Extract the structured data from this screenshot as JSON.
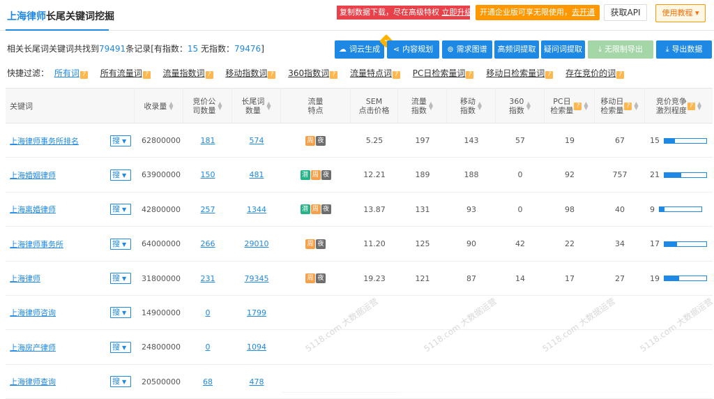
{
  "header": {
    "title_accent": "上海律师",
    "title_rest": "长尾关键词挖掘",
    "promo_red_text": "复制数据下载，尽在高级特权 ",
    "promo_red_link": "立即升级",
    "promo_orange_text": "开通企业版可享无限使用，",
    "promo_orange_link": "去开通",
    "api_label": "获取API",
    "guide_label": "使用教程 ▾"
  },
  "summary": {
    "prefix": "相关长尾词关键词共找到",
    "total": "79491",
    "mid": "条记录[有指数：",
    "with_index": "15",
    "mid2": "  无指数：",
    "without_index": "79476",
    "suffix": "]"
  },
  "actions": [
    {
      "label": "词云生成",
      "icon": "☁"
    },
    {
      "label": "内容规划",
      "icon": "⋖"
    },
    {
      "label": "需求图谱",
      "icon": "⊚"
    },
    {
      "label": "高频词提取",
      "icon": ""
    },
    {
      "label": "疑问词提取",
      "icon": ""
    },
    {
      "label": "无限制导出",
      "icon": "⤓"
    },
    {
      "label": "导出数据",
      "icon": "⤓"
    }
  ],
  "filter": {
    "label": "快捷过滤：",
    "items": [
      "所有词",
      "所有流量词",
      "流量指数词",
      "移动指数词",
      "360指数词",
      "流量特点词",
      "PC日检索量词",
      "移动日检索量词",
      "存在竞价的词"
    ]
  },
  "columns": {
    "keyword": "关键词",
    "indexed": "收录量",
    "bid_companies": "竞价公\n司数量",
    "longtail": "长尾词\n数量",
    "traits": "流量\n特点",
    "sem": "SEM\n点击价格",
    "flow_index": "流量\n指数",
    "mobile_index": "移动\n指数",
    "index_360": "360\n指数",
    "pc_daily": "PC日\n检索量",
    "mobile_daily": "移动日\n检索量",
    "competition": "竞价竞争\n激烈程度"
  },
  "search_tag": "搜",
  "rows": [
    {
      "kw": "上海律师事务所排名",
      "indexed": "62800000",
      "bid": "181",
      "lt": "574",
      "traits": [
        "周",
        "夜"
      ],
      "sem": "5.25",
      "flow": "197",
      "mobile": "143",
      "i360": "57",
      "pc": "19",
      "md": "67",
      "comp": "15",
      "comp_frac": 0.25
    },
    {
      "kw": "上海婚姻律师",
      "indexed": "63900000",
      "bid": "150",
      "lt": "481",
      "traits": [
        "潜",
        "周",
        "夜"
      ],
      "sem": "12.21",
      "flow": "189",
      "mobile": "188",
      "i360": "0",
      "pc": "92",
      "md": "757",
      "comp": "21",
      "comp_frac": 0.4
    },
    {
      "kw": "上海离婚律师",
      "indexed": "42800000",
      "bid": "257",
      "lt": "1344",
      "traits": [
        "潜",
        "周",
        "夜"
      ],
      "sem": "13.87",
      "flow": "131",
      "mobile": "93",
      "i360": "0",
      "pc": "98",
      "md": "40",
      "comp": "9",
      "comp_frac": 0.12
    },
    {
      "kw": "上海律师事务所",
      "indexed": "64000000",
      "bid": "266",
      "lt": "29010",
      "traits": [
        "周",
        "夜"
      ],
      "sem": "11.20",
      "flow": "125",
      "mobile": "90",
      "i360": "42",
      "pc": "22",
      "md": "34",
      "comp": "17",
      "comp_frac": 0.3
    },
    {
      "kw": "上海律师",
      "indexed": "31800000",
      "bid": "231",
      "lt": "79345",
      "traits": [
        "周",
        "夜"
      ],
      "sem": "19.23",
      "flow": "121",
      "mobile": "87",
      "i360": "14",
      "pc": "17",
      "md": "27",
      "comp": "19",
      "comp_frac": 0.35
    },
    {
      "kw": "上海律师咨询",
      "indexed": "14900000",
      "bid": "0",
      "lt": "1799",
      "traits": [],
      "sem": "",
      "flow": "",
      "mobile": "",
      "i360": "",
      "pc": "",
      "md": "",
      "comp": "",
      "comp_frac": null
    },
    {
      "kw": "上海房产律师",
      "indexed": "24800000",
      "bid": "0",
      "lt": "1094",
      "traits": [],
      "sem": "",
      "flow": "",
      "mobile": "",
      "i360": "",
      "pc": "",
      "md": "",
      "comp": "",
      "comp_frac": null
    },
    {
      "kw": "上海律师查询",
      "indexed": "20500000",
      "bid": "68",
      "lt": "478",
      "traits": [],
      "sem": "",
      "flow": "",
      "mobile": "",
      "i360": "",
      "pc": "",
      "md": "",
      "comp": "",
      "comp_frac": null
    }
  ],
  "watermark": "5118.com 大数据运营",
  "colors": {
    "primary": "#1e88e5",
    "promo_red": "#e8414a",
    "promo_orange": "#ff9800",
    "trait_week": "#f5a04a",
    "trait_night": "#6d6d6d",
    "trait_latent": "#26b38a"
  }
}
